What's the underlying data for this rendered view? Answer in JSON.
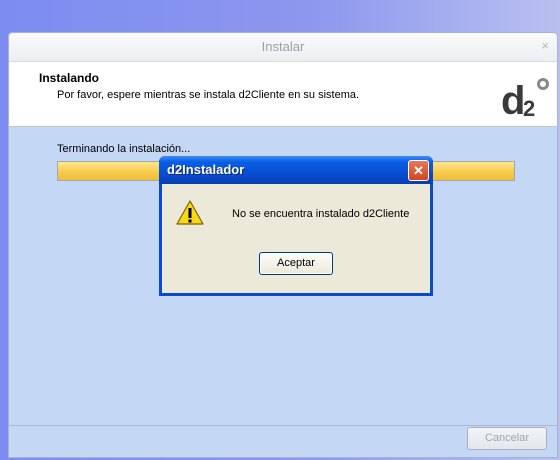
{
  "window": {
    "title": "Instalar",
    "close_glyph": "×"
  },
  "header": {
    "title": "Instalando",
    "subtitle": "Por favor, espere mientras se instala d2Cliente en su sistema.",
    "logo_text": "d2",
    "logo_icon": "d2-logo-icon"
  },
  "progress": {
    "status_text": "Terminando la instalación...",
    "fraction": 1.0
  },
  "footer": {
    "cancel_label": "Cancelar"
  },
  "dialog": {
    "title": "d2Instalador",
    "close_glyph": "✕",
    "message": "No se encuentra instalado d2Cliente",
    "ok_label": "Aceptar",
    "icon": "warning-icon"
  }
}
